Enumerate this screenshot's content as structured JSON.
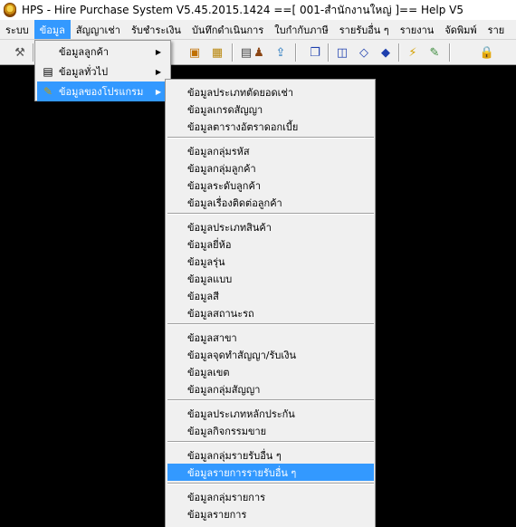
{
  "window": {
    "title": "HPS - Hire Purchase System V5.45.2015.1424 ==[ 001-สำนักงานใหญ่ ]== Help V5"
  },
  "menubar": {
    "items": [
      {
        "label": "ระบบ"
      },
      {
        "label": "ข้อมูล"
      },
      {
        "label": "สัญญาเช่า"
      },
      {
        "label": "รับชำระเงิน"
      },
      {
        "label": "บันทึกดำเนินการ"
      },
      {
        "label": "ใบกำกับภาษี"
      },
      {
        "label": "รายรับอื่น ๆ"
      },
      {
        "label": "รายงาน"
      },
      {
        "label": "จัดพิมพ์"
      },
      {
        "label": "ราย"
      }
    ],
    "active_index": 1
  },
  "toolbar": {
    "icons": [
      "tools-icon",
      "report-icon",
      "calendar-icon",
      "users-icon",
      "export-icon",
      "copy-icon",
      "book-icon",
      "book-open-icon",
      "tag-icon",
      "bolt-icon",
      "wand-icon",
      "lock-icon"
    ]
  },
  "menu_data": {
    "items": [
      {
        "label": "ข้อมูลลูกค้า"
      },
      {
        "label": "ข้อมูลทั่วไป"
      },
      {
        "label": "ข้อมูลของโปรแกรม"
      }
    ],
    "highlighted_index": 2
  },
  "submenu": {
    "groups": [
      [
        "ข้อมูลประเภทตัดยอดเช่า",
        "ข้อมูลเกรดสัญญา",
        "ข้อมูลตารางอัตราดอกเบี้ย"
      ],
      [
        "ข้อมูลกลุ่มรหัส",
        "ข้อมูลกลุ่มลูกค้า",
        "ข้อมูลระดับลูกค้า",
        "ข้อมูลเรื่องติดต่อลูกค้า"
      ],
      [
        "ข้อมูลประเภทสินค้า",
        "ข้อมูลยี่ห้อ",
        "ข้อมูลรุ่น",
        "ข้อมูลแบบ",
        "ข้อมูลสี",
        "ข้อมูลสถานะรถ"
      ],
      [
        "ข้อมูลสาขา",
        "ข้อมูลจุดทำสัญญา/รับเงิน",
        "ข้อมูลเขต",
        "ข้อมูลกลุ่มสัญญา"
      ],
      [
        "ข้อมูลประเภทหลักประกัน",
        "ข้อมูลกิจกรรมขาย"
      ],
      [
        "ข้อมูลกลุ่มรายรับอื่น ๆ",
        "ข้อมูลรายการรายรับอื่น ๆ"
      ],
      [
        "ข้อมูลกลุ่มรายการ",
        "ข้อมูลรายการ"
      ]
    ],
    "highlighted_label": "ข้อมูลรายการรายรับอื่น ๆ"
  },
  "colors": {
    "highlight": "#3399ff",
    "menu_bg": "#f0f0f0",
    "desktop_bg": "#000000"
  }
}
